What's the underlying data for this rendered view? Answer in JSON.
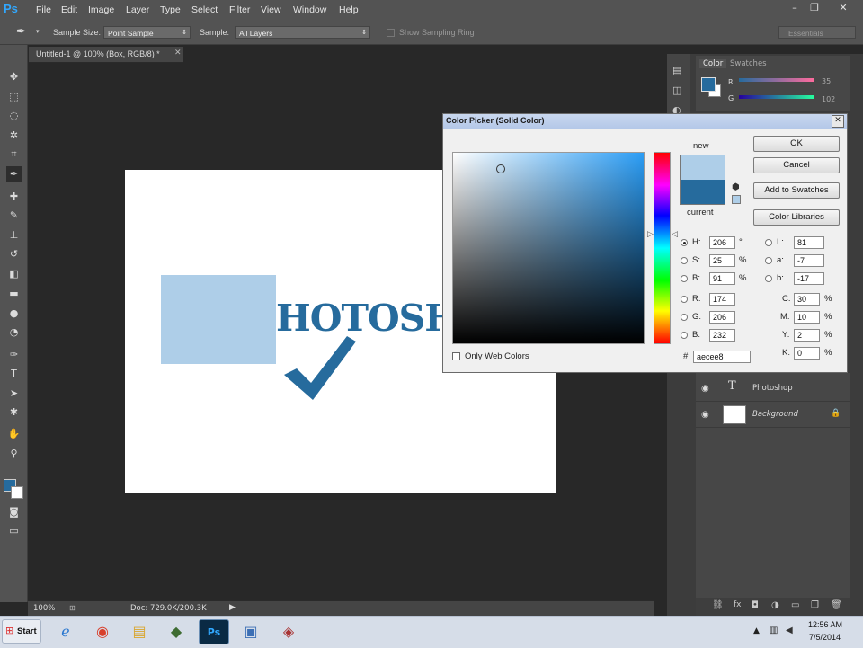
{
  "app": {
    "logo": "Ps",
    "menu": [
      "File",
      "Edit",
      "Image",
      "Layer",
      "Type",
      "Select",
      "Filter",
      "View",
      "Window",
      "Help"
    ],
    "window_controls": [
      "–",
      "❐",
      "✕"
    ]
  },
  "options_bar": {
    "sample_size_label": "Sample Size:",
    "sample_size_value": "Point Sample",
    "sample_label": "Sample:",
    "sample_value": "All Layers",
    "show_ring_label": "Show Sampling Ring",
    "workspace": "Essentials"
  },
  "document": {
    "tab_title": "Untitled-1 @ 100% (Box, RGB/8) *",
    "canvas_text": "HOTOSH",
    "zoom": "100%",
    "doc_size": "Doc: 729.0K/200.3K"
  },
  "panels": {
    "color_tab": "Color",
    "swatches_tab": "Swatches",
    "r_label": "R",
    "g_label": "G",
    "r_value": "35",
    "g_value": "102",
    "layers": [
      {
        "name": "Photoshop",
        "type": "text"
      },
      {
        "name": "Background",
        "type": "image"
      }
    ]
  },
  "colors": {
    "foreground": "#266b9d",
    "new_color": "#aecee8",
    "current_color": "#266b9d",
    "canvas_text": "#266b9d"
  },
  "color_picker": {
    "title": "Color Picker (Solid Color)",
    "new_label": "new",
    "current_label": "current",
    "ok": "OK",
    "cancel": "Cancel",
    "add_to_swatches": "Add to Swatches",
    "color_libraries": "Color Libraries",
    "only_web_colors": "Only Web Colors",
    "hsb": {
      "H": "206",
      "S": "25",
      "B": "91"
    },
    "rgb": {
      "R": "174",
      "G": "206",
      "B": "232"
    },
    "lab": {
      "L": "81",
      "a": "-7",
      "b": "-17"
    },
    "cmyk": {
      "C": "30",
      "M": "10",
      "Y": "2",
      "K": "0"
    },
    "hex": "aecee8",
    "units": {
      "deg": "°",
      "pct": "%"
    }
  },
  "taskbar": {
    "start": "Start",
    "time": "12:56 AM",
    "date": "7/5/2014"
  }
}
